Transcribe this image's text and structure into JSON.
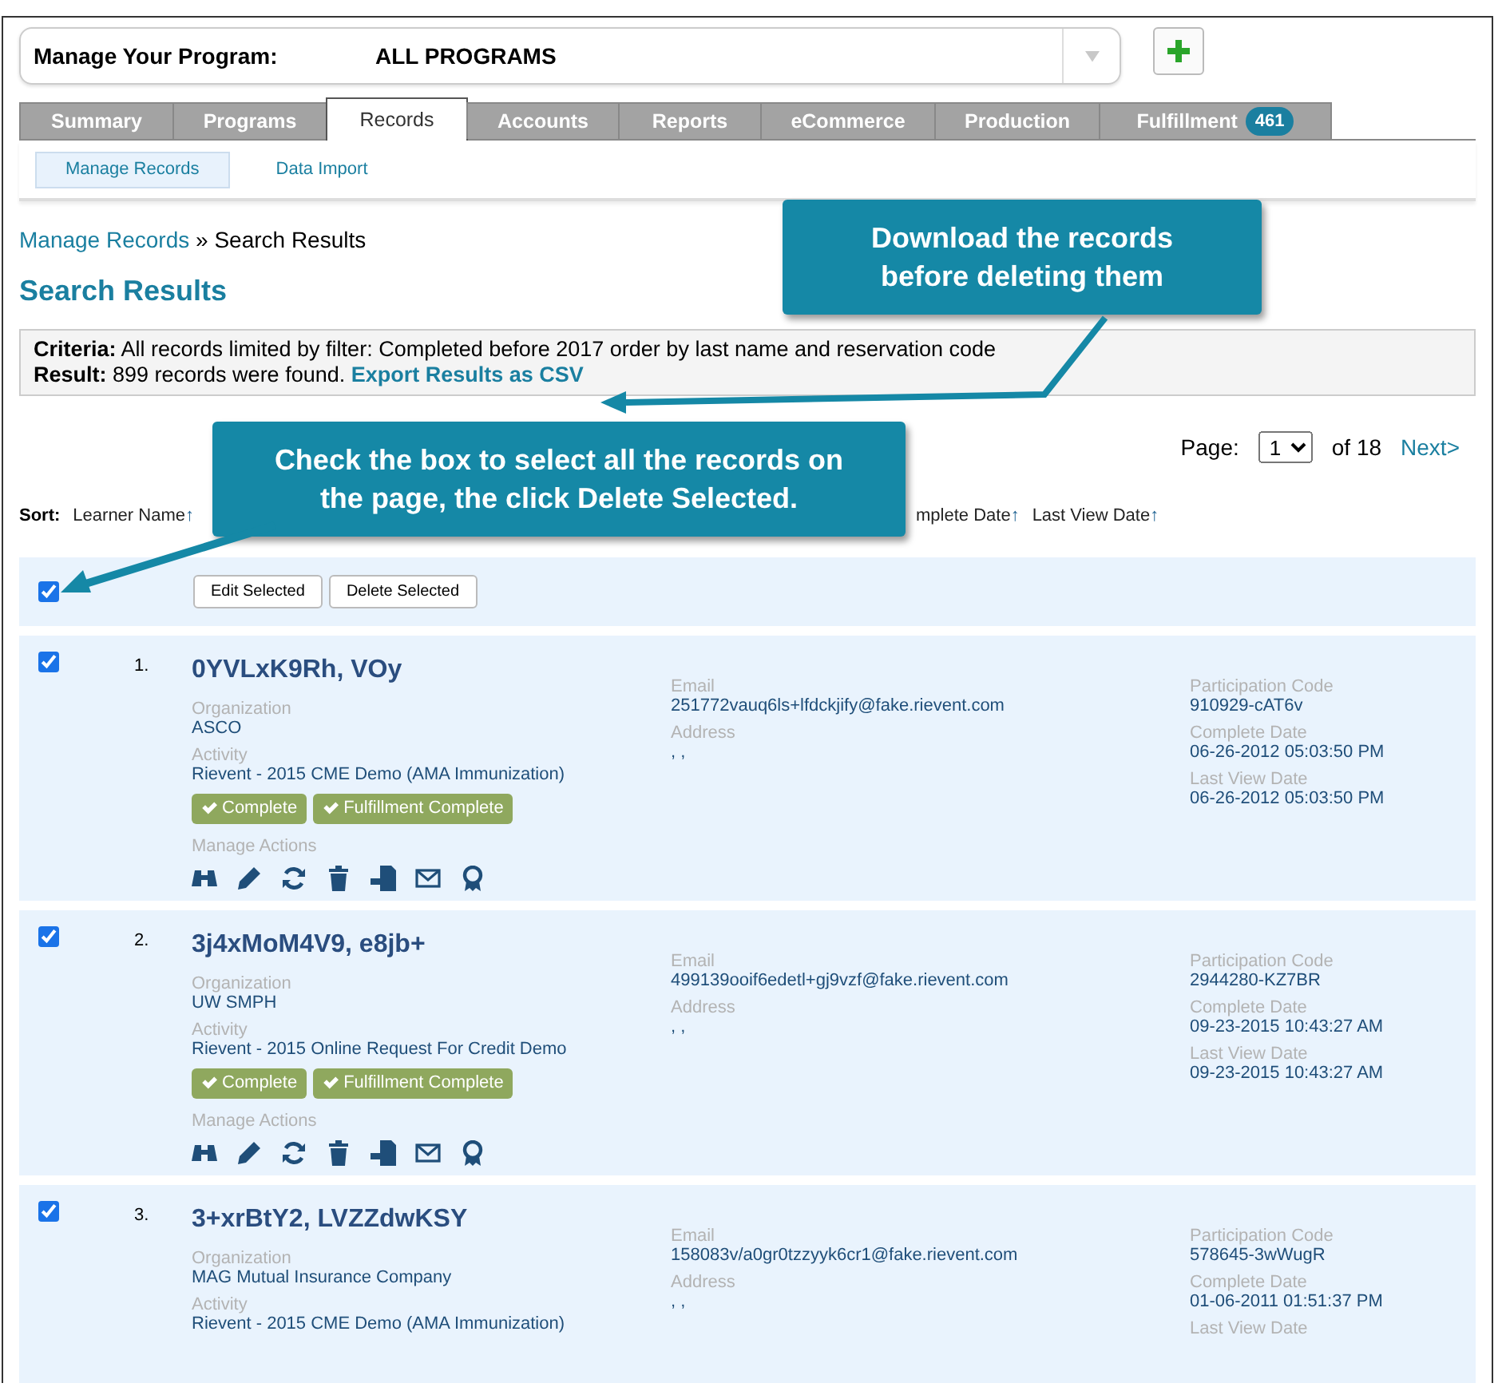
{
  "program_selector": {
    "label": "Manage Your Program:",
    "value": "ALL PROGRAMS"
  },
  "tabs": [
    {
      "label": "Summary",
      "selected": false
    },
    {
      "label": "Programs",
      "selected": false
    },
    {
      "label": "Records",
      "selected": true
    },
    {
      "label": "Accounts",
      "selected": false
    },
    {
      "label": "Reports",
      "selected": false
    },
    {
      "label": "eCommerce",
      "selected": false
    },
    {
      "label": "Production",
      "selected": false
    },
    {
      "label": "Fulfillment",
      "selected": false,
      "badge": "461"
    }
  ],
  "subtabs": [
    {
      "label": "Manage Records",
      "selected": true
    },
    {
      "label": "Data Import",
      "selected": false
    }
  ],
  "breadcrumb": {
    "link": "Manage Records",
    "separator": "»",
    "current": "Search Results"
  },
  "title": "Search Results",
  "criteria": {
    "criteria_label": "Criteria:",
    "criteria_text": "All records limited by filter: Completed before 2017 order by last name and reservation code",
    "result_label": "Result:",
    "result_text": "899 records were found.",
    "export_link": "Export Results as CSV"
  },
  "pager": {
    "label": "Page:",
    "value": "1",
    "of_text": "of",
    "total": "18",
    "next": "Next>"
  },
  "sort": {
    "label": "Sort:",
    "arrow": "↑",
    "items": [
      "Learner Name",
      "mplete Date",
      "Last View Date"
    ]
  },
  "select_all": {
    "checked": true,
    "buttons": [
      "Edit Selected",
      "Delete Selected"
    ]
  },
  "records": [
    {
      "checked": true,
      "number": "1.",
      "name": "0YVLxK9Rh, VOy",
      "organization_label": "Organization",
      "organization": "ASCO",
      "activity_label": "Activity",
      "activity": "Rievent - 2015 CME Demo (AMA Immunization)",
      "badges": [
        "Complete",
        "Fulfillment Complete"
      ],
      "actions_label": "Manage Actions",
      "email_label": "Email",
      "email": "251772vauq6ls+lfdckjify@fake.rievent.com",
      "address_label": "Address",
      "address": ", ,",
      "code_label": "Participation Code",
      "code": "910929-cAT6v",
      "complete_label": "Complete Date",
      "complete": "06-26-2012 05:03:50 PM",
      "last_view_label": "Last View Date",
      "last_view": "06-26-2012 05:03:50 PM"
    },
    {
      "checked": true,
      "number": "2.",
      "name": "3j4xMoM4V9, e8jb+",
      "organization_label": "Organization",
      "organization": "UW SMPH",
      "activity_label": "Activity",
      "activity": "Rievent - 2015 Online Request For Credit Demo",
      "badges": [
        "Complete",
        "Fulfillment Complete"
      ],
      "actions_label": "Manage Actions",
      "email_label": "Email",
      "email": "499139ooif6edetl+gj9vzf@fake.rievent.com",
      "address_label": "Address",
      "address": ", ,",
      "code_label": "Participation Code",
      "code": "2944280-KZ7BR",
      "complete_label": "Complete Date",
      "complete": "09-23-2015 10:43:27 AM",
      "last_view_label": "Last View Date",
      "last_view": "09-23-2015 10:43:27 AM"
    },
    {
      "checked": true,
      "number": "3.",
      "name": "3+xrBtY2, LVZZdwKSY",
      "organization_label": "Organization",
      "organization": "MAG Mutual Insurance Company",
      "activity_label": "Activity",
      "activity": "Rievent - 2015 CME Demo (AMA Immunization)",
      "email_label": "Email",
      "email": "158083v/a0gr0tzzyyk6cr1@fake.rievent.com",
      "address_label": "Address",
      "address": ", ,",
      "code_label": "Participation Code",
      "code": "578645-3wWugR",
      "complete_label": "Complete Date",
      "complete": "01-06-2011 01:51:37 PM",
      "last_view_label": "Last View Date"
    }
  ],
  "callouts": [
    {
      "text": "Download the records before deleting them"
    },
    {
      "text": "Check the box to select all the records on the page, the click Delete Selected."
    }
  ]
}
